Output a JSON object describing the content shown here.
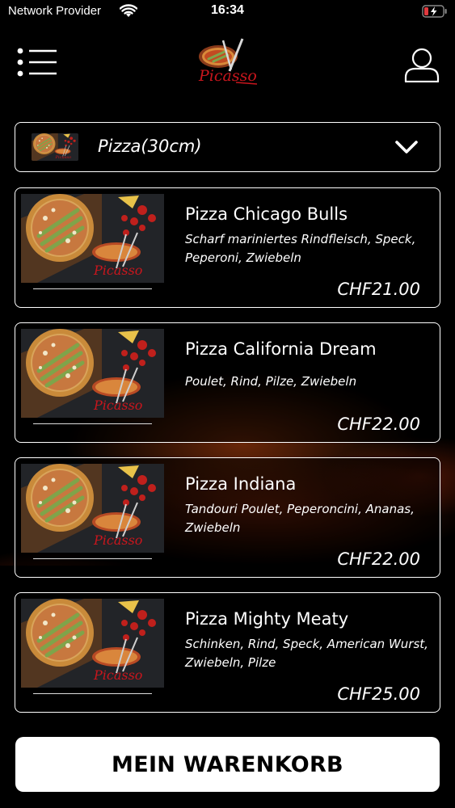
{
  "status_bar": {
    "carrier": "Network Provider",
    "time": "16:34",
    "battery_color": "#e0393e"
  },
  "header": {
    "logo_text": "Picasso",
    "menu_icon": "list-menu-icon",
    "user_icon": "user-icon"
  },
  "category": {
    "selected": "Pizza(30cm)"
  },
  "products": [
    {
      "name": "Pizza Chicago Bulls",
      "description": "Scharf mariniertes Rindfleisch, Speck, Peperoni, Zwiebeln",
      "price": "CHF21.00"
    },
    {
      "name": "Pizza California Dream",
      "description": "Poulet, Rind, Pilze, Zwiebeln",
      "price": "CHF22.00"
    },
    {
      "name": "Pizza Indiana",
      "description": "Tandouri Poulet, Peperoncini, Ananas, Zwiebeln",
      "price": "CHF22.00"
    },
    {
      "name": "Pizza Mighty Meaty",
      "description": "Schinken, Rind, Speck, American Wurst, Zwiebeln, Pilze",
      "price": "CHF25.00"
    }
  ],
  "cart": {
    "label": "MEIN WARENKORB"
  },
  "colors": {
    "background": "#000000",
    "border": "#ffffff",
    "logo_red": "#c8161d"
  }
}
